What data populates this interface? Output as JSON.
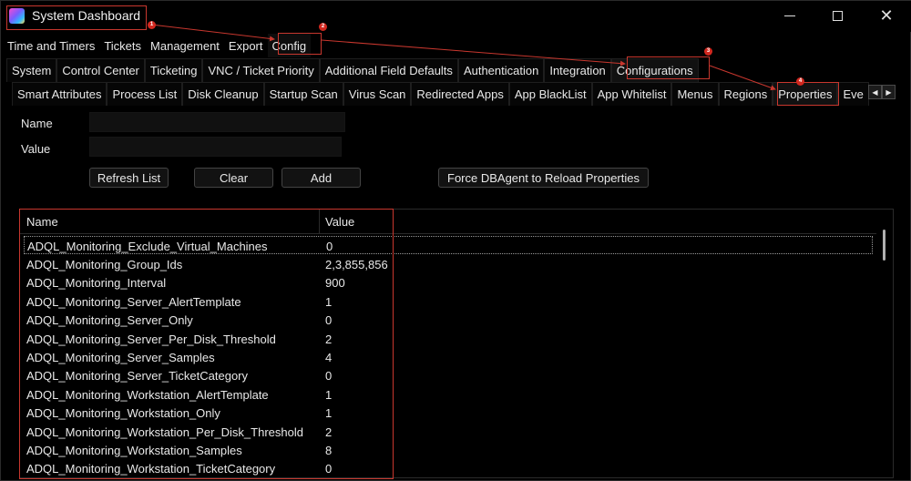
{
  "window": {
    "title": "System Dashboard",
    "icon": "app-logo-icon",
    "controls": {
      "minimize_icon": "minimize-icon",
      "maximize_icon": "maximize-icon",
      "close_label": "✕"
    }
  },
  "menu": [
    "Time and Timers",
    "Tickets",
    "Management",
    "Export",
    "Config"
  ],
  "config_tabs": [
    "System",
    "Control Center",
    "Ticketing",
    "VNC / Ticket Priority",
    "Additional Field Defaults",
    "Authentication",
    "Integration",
    "Configurations"
  ],
  "config_sub_tabs": [
    "Smart Attributes",
    "Process List",
    "Disk Cleanup",
    "Startup Scan",
    "Virus Scan",
    "Redirected Apps",
    "App BlackList",
    "App Whitelist",
    "Menus",
    "Regions",
    "Properties",
    "Eve"
  ],
  "tab_scroll": {
    "left": "◀",
    "right": "▶"
  },
  "form": {
    "name_label": "Name",
    "name_value": "",
    "value_label": "Value",
    "value_value": ""
  },
  "buttons": {
    "refresh": "Refresh List",
    "clear": "Clear",
    "add": "Add",
    "force_reload": "Force DBAgent to Reload Properties"
  },
  "table": {
    "columns": [
      "Name",
      "Value"
    ],
    "rows": [
      [
        "ADQL_Monitoring_Exclude_Virtual_Machines",
        "0"
      ],
      [
        "ADQL_Monitoring_Group_Ids",
        "2,3,855,856"
      ],
      [
        "ADQL_Monitoring_Interval",
        "900"
      ],
      [
        "ADQL_Monitoring_Server_AlertTemplate",
        "1"
      ],
      [
        "ADQL_Monitoring_Server_Only",
        "0"
      ],
      [
        "ADQL_Monitoring_Server_Per_Disk_Threshold",
        "2"
      ],
      [
        "ADQL_Monitoring_Server_Samples",
        "4"
      ],
      [
        "ADQL_Monitoring_Server_TicketCategory",
        "0"
      ],
      [
        "ADQL_Monitoring_Workstation_AlertTemplate",
        "1"
      ],
      [
        "ADQL_Monitoring_Workstation_Only",
        "1"
      ],
      [
        "ADQL_Monitoring_Workstation_Per_Disk_Threshold",
        "2"
      ],
      [
        "ADQL_Monitoring_Workstation_Samples",
        "8"
      ],
      [
        "ADQL_Monitoring_Workstation_TicketCategory",
        "0"
      ]
    ]
  },
  "annotations": {
    "markers": [
      "1",
      "2",
      "3",
      "4"
    ],
    "color": "#c8372e"
  },
  "colors": {
    "background": "#000000",
    "text": "#e8e8e8",
    "highlight": "#c8372e"
  }
}
